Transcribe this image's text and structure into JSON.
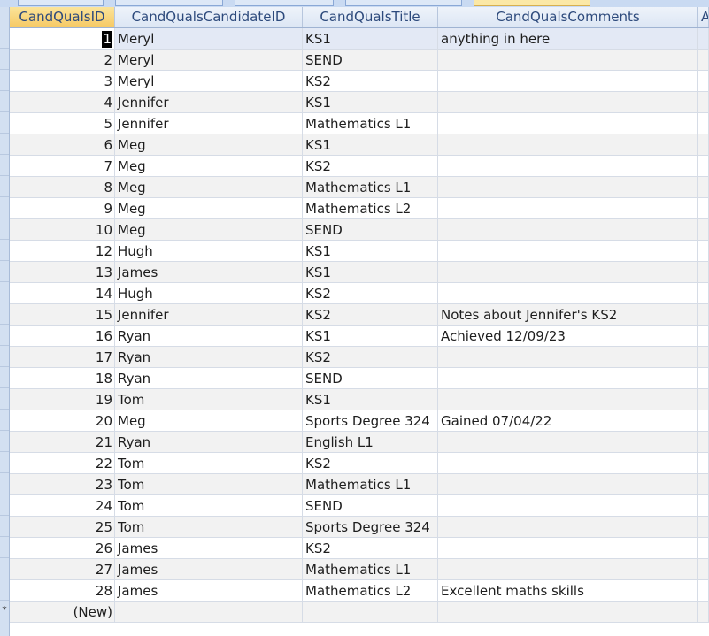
{
  "columns": [
    {
      "label": "CandQualsID"
    },
    {
      "label": "CandQualsCandidateID"
    },
    {
      "label": "CandQualsTitle"
    },
    {
      "label": "CandQualsComments"
    },
    {
      "label": "A"
    }
  ],
  "rows": [
    {
      "id": "1",
      "candidate": "Meryl",
      "title": "KS1",
      "comments": "anything in here"
    },
    {
      "id": "2",
      "candidate": "Meryl",
      "title": "SEND",
      "comments": ""
    },
    {
      "id": "3",
      "candidate": "Meryl",
      "title": "KS2",
      "comments": ""
    },
    {
      "id": "4",
      "candidate": "Jennifer",
      "title": "KS1",
      "comments": ""
    },
    {
      "id": "5",
      "candidate": "Jennifer",
      "title": "Mathematics L1",
      "comments": ""
    },
    {
      "id": "6",
      "candidate": "Meg",
      "title": "KS1",
      "comments": ""
    },
    {
      "id": "7",
      "candidate": "Meg",
      "title": "KS2",
      "comments": ""
    },
    {
      "id": "8",
      "candidate": "Meg",
      "title": "Mathematics L1",
      "comments": ""
    },
    {
      "id": "9",
      "candidate": "Meg",
      "title": "Mathematics L2",
      "comments": ""
    },
    {
      "id": "10",
      "candidate": "Meg",
      "title": "SEND",
      "comments": ""
    },
    {
      "id": "12",
      "candidate": "Hugh",
      "title": "KS1",
      "comments": ""
    },
    {
      "id": "13",
      "candidate": "James",
      "title": "KS1",
      "comments": ""
    },
    {
      "id": "14",
      "candidate": "Hugh",
      "title": "KS2",
      "comments": ""
    },
    {
      "id": "15",
      "candidate": "Jennifer",
      "title": "KS2",
      "comments": "Notes about Jennifer's KS2"
    },
    {
      "id": "16",
      "candidate": "Ryan",
      "title": "KS1",
      "comments": "Achieved 12/09/23"
    },
    {
      "id": "17",
      "candidate": "Ryan",
      "title": "KS2",
      "comments": ""
    },
    {
      "id": "18",
      "candidate": "Ryan",
      "title": "SEND",
      "comments": ""
    },
    {
      "id": "19",
      "candidate": "Tom",
      "title": "KS1",
      "comments": ""
    },
    {
      "id": "20",
      "candidate": "Meg",
      "title": "Sports Degree 324",
      "comments": "Gained 07/04/22"
    },
    {
      "id": "21",
      "candidate": "Ryan",
      "title": "English L1",
      "comments": ""
    },
    {
      "id": "22",
      "candidate": "Tom",
      "title": "KS2",
      "comments": ""
    },
    {
      "id": "23",
      "candidate": "Tom",
      "title": "Mathematics L1",
      "comments": ""
    },
    {
      "id": "24",
      "candidate": "Tom",
      "title": "SEND",
      "comments": ""
    },
    {
      "id": "25",
      "candidate": "Tom",
      "title": "Sports Degree 324",
      "comments": ""
    },
    {
      "id": "26",
      "candidate": "James",
      "title": "KS2",
      "comments": ""
    },
    {
      "id": "27",
      "candidate": "James",
      "title": "Mathematics L1",
      "comments": ""
    },
    {
      "id": "28",
      "candidate": "James",
      "title": "Mathematics L2",
      "comments": "Excellent maths skills"
    }
  ],
  "new_row": {
    "id": "(New)",
    "selector_glyph": "*"
  },
  "colors": {
    "header_bg": "#dce6f4",
    "selected_header": "#f6c964",
    "alt_row": "#f2f2f2",
    "current_row": "#e3e9f5",
    "header_text": "#2d4a7c"
  }
}
